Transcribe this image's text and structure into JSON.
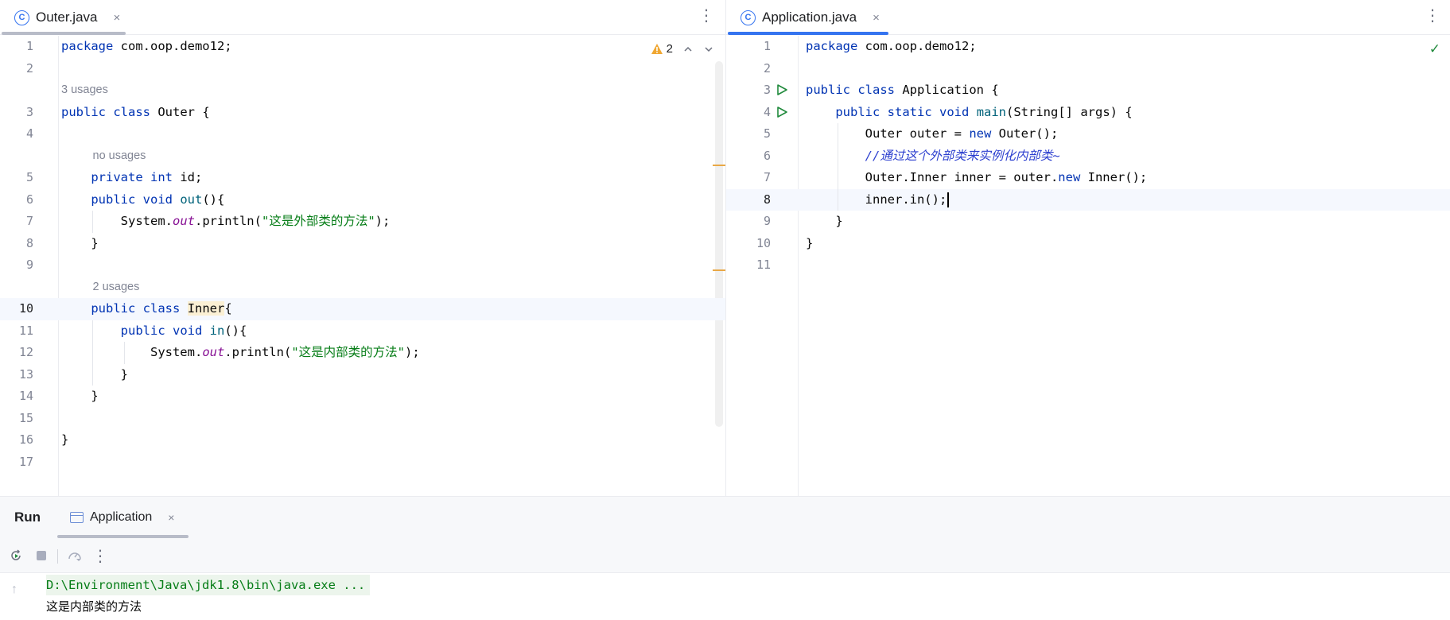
{
  "left_editor": {
    "tab": {
      "label": "Outer.java",
      "icon": "java-class-icon",
      "close": "×"
    },
    "warnings": {
      "count": "2"
    },
    "lines": [
      {
        "n": "1",
        "hint": "",
        "tokens": [
          [
            "kw",
            "package"
          ],
          [
            "",
            " com.oop.demo12;"
          ]
        ]
      },
      {
        "n": "2",
        "hint": "",
        "tokens": []
      },
      {
        "n": "",
        "hint": "3 usages",
        "hint_indent": 0,
        "tokens": []
      },
      {
        "n": "3",
        "hint": "",
        "tokens": [
          [
            "kw",
            "public"
          ],
          [
            "",
            " "
          ],
          [
            "kw",
            "class"
          ],
          [
            "",
            " Outer {"
          ]
        ]
      },
      {
        "n": "4",
        "hint": "",
        "tokens": []
      },
      {
        "n": "",
        "hint": "no usages",
        "hint_indent": 1,
        "tokens": []
      },
      {
        "n": "5",
        "hint": "",
        "tokens": [
          [
            "",
            "    "
          ],
          [
            "kw",
            "private"
          ],
          [
            "",
            " "
          ],
          [
            "kw",
            "int"
          ],
          [
            "",
            " id;"
          ]
        ]
      },
      {
        "n": "6",
        "hint": "",
        "tokens": [
          [
            "",
            "    "
          ],
          [
            "kw",
            "public"
          ],
          [
            "",
            " "
          ],
          [
            "kw",
            "void"
          ],
          [
            "",
            " "
          ],
          [
            "fn",
            "out"
          ],
          [
            "",
            "(){"
          ]
        ]
      },
      {
        "n": "7",
        "hint": "",
        "tokens": [
          [
            "",
            "        System."
          ],
          [
            "field-static",
            "out"
          ],
          [
            "",
            ".println("
          ],
          [
            "str",
            "\"这是外部类的方法\""
          ],
          [
            "",
            ");"
          ]
        ]
      },
      {
        "n": "8",
        "hint": "",
        "tokens": [
          [
            "",
            "    }"
          ]
        ]
      },
      {
        "n": "9",
        "hint": "",
        "tokens": []
      },
      {
        "n": "",
        "hint": "2 usages",
        "hint_indent": 1,
        "tokens": []
      },
      {
        "n": "10",
        "hint": "",
        "current": true,
        "tokens": [
          [
            "",
            "    "
          ],
          [
            "kw",
            "public"
          ],
          [
            "",
            " "
          ],
          [
            "kw",
            "class"
          ],
          [
            "",
            " "
          ],
          [
            "ident-hl",
            "Inner"
          ],
          [
            "",
            "{"
          ]
        ]
      },
      {
        "n": "11",
        "hint": "",
        "tokens": [
          [
            "",
            "        "
          ],
          [
            "kw",
            "public"
          ],
          [
            "",
            " "
          ],
          [
            "kw",
            "void"
          ],
          [
            "",
            " "
          ],
          [
            "fn",
            "in"
          ],
          [
            "",
            "(){"
          ]
        ]
      },
      {
        "n": "12",
        "hint": "",
        "tokens": [
          [
            "",
            "            System."
          ],
          [
            "field-static",
            "out"
          ],
          [
            "",
            ".println("
          ],
          [
            "str",
            "\"这是内部类的方法\""
          ],
          [
            "",
            ");"
          ]
        ]
      },
      {
        "n": "13",
        "hint": "",
        "tokens": [
          [
            "",
            "        }"
          ]
        ]
      },
      {
        "n": "14",
        "hint": "",
        "tokens": [
          [
            "",
            "    }"
          ]
        ]
      },
      {
        "n": "15",
        "hint": "",
        "tokens": []
      },
      {
        "n": "16",
        "hint": "",
        "tokens": [
          [
            "",
            "}"
          ]
        ]
      },
      {
        "n": "17",
        "hint": "",
        "tokens": []
      }
    ]
  },
  "right_editor": {
    "tab": {
      "label": "Application.java",
      "icon": "java-class-icon",
      "close": "×"
    },
    "status": "no-problems",
    "lines": [
      {
        "n": "1",
        "run": false,
        "tokens": [
          [
            "kw",
            "package"
          ],
          [
            "",
            " com.oop.demo12;"
          ]
        ]
      },
      {
        "n": "2",
        "run": false,
        "tokens": []
      },
      {
        "n": "3",
        "run": true,
        "tokens": [
          [
            "kw",
            "public"
          ],
          [
            "",
            " "
          ],
          [
            "kw",
            "class"
          ],
          [
            "",
            " Application {"
          ]
        ]
      },
      {
        "n": "4",
        "run": true,
        "tokens": [
          [
            "",
            "    "
          ],
          [
            "kw",
            "public"
          ],
          [
            "",
            " "
          ],
          [
            "kw",
            "static"
          ],
          [
            "",
            " "
          ],
          [
            "kw",
            "void"
          ],
          [
            "",
            " "
          ],
          [
            "fn",
            "main"
          ],
          [
            "",
            "(String[] args) {"
          ]
        ]
      },
      {
        "n": "5",
        "run": false,
        "tokens": [
          [
            "",
            "        Outer outer = "
          ],
          [
            "kw",
            "new"
          ],
          [
            "",
            " Outer();"
          ]
        ]
      },
      {
        "n": "6",
        "run": false,
        "tokens": [
          [
            "",
            "        "
          ],
          [
            "cmt",
            "//通过这个外部类来实例化内部类~"
          ]
        ]
      },
      {
        "n": "7",
        "run": false,
        "tokens": [
          [
            "",
            "        Outer.Inner inner = outer."
          ],
          [
            "kw",
            "new"
          ],
          [
            "",
            " Inner();"
          ]
        ]
      },
      {
        "n": "8",
        "run": false,
        "current": true,
        "tokens": [
          [
            "",
            "        inner.in();"
          ]
        ]
      },
      {
        "n": "9",
        "run": false,
        "tokens": [
          [
            "",
            "    }"
          ]
        ]
      },
      {
        "n": "10",
        "run": false,
        "tokens": [
          [
            "",
            "}"
          ]
        ]
      },
      {
        "n": "11",
        "run": false,
        "tokens": []
      }
    ]
  },
  "run_panel": {
    "title": "Run",
    "tab_label": "Application",
    "tab_close": "×",
    "console": [
      {
        "kind": "cmd",
        "text": "D:\\Environment\\Java\\jdk1.8\\bin\\java.exe ..."
      },
      {
        "kind": "out",
        "text": "这是内部类的方法"
      }
    ]
  }
}
